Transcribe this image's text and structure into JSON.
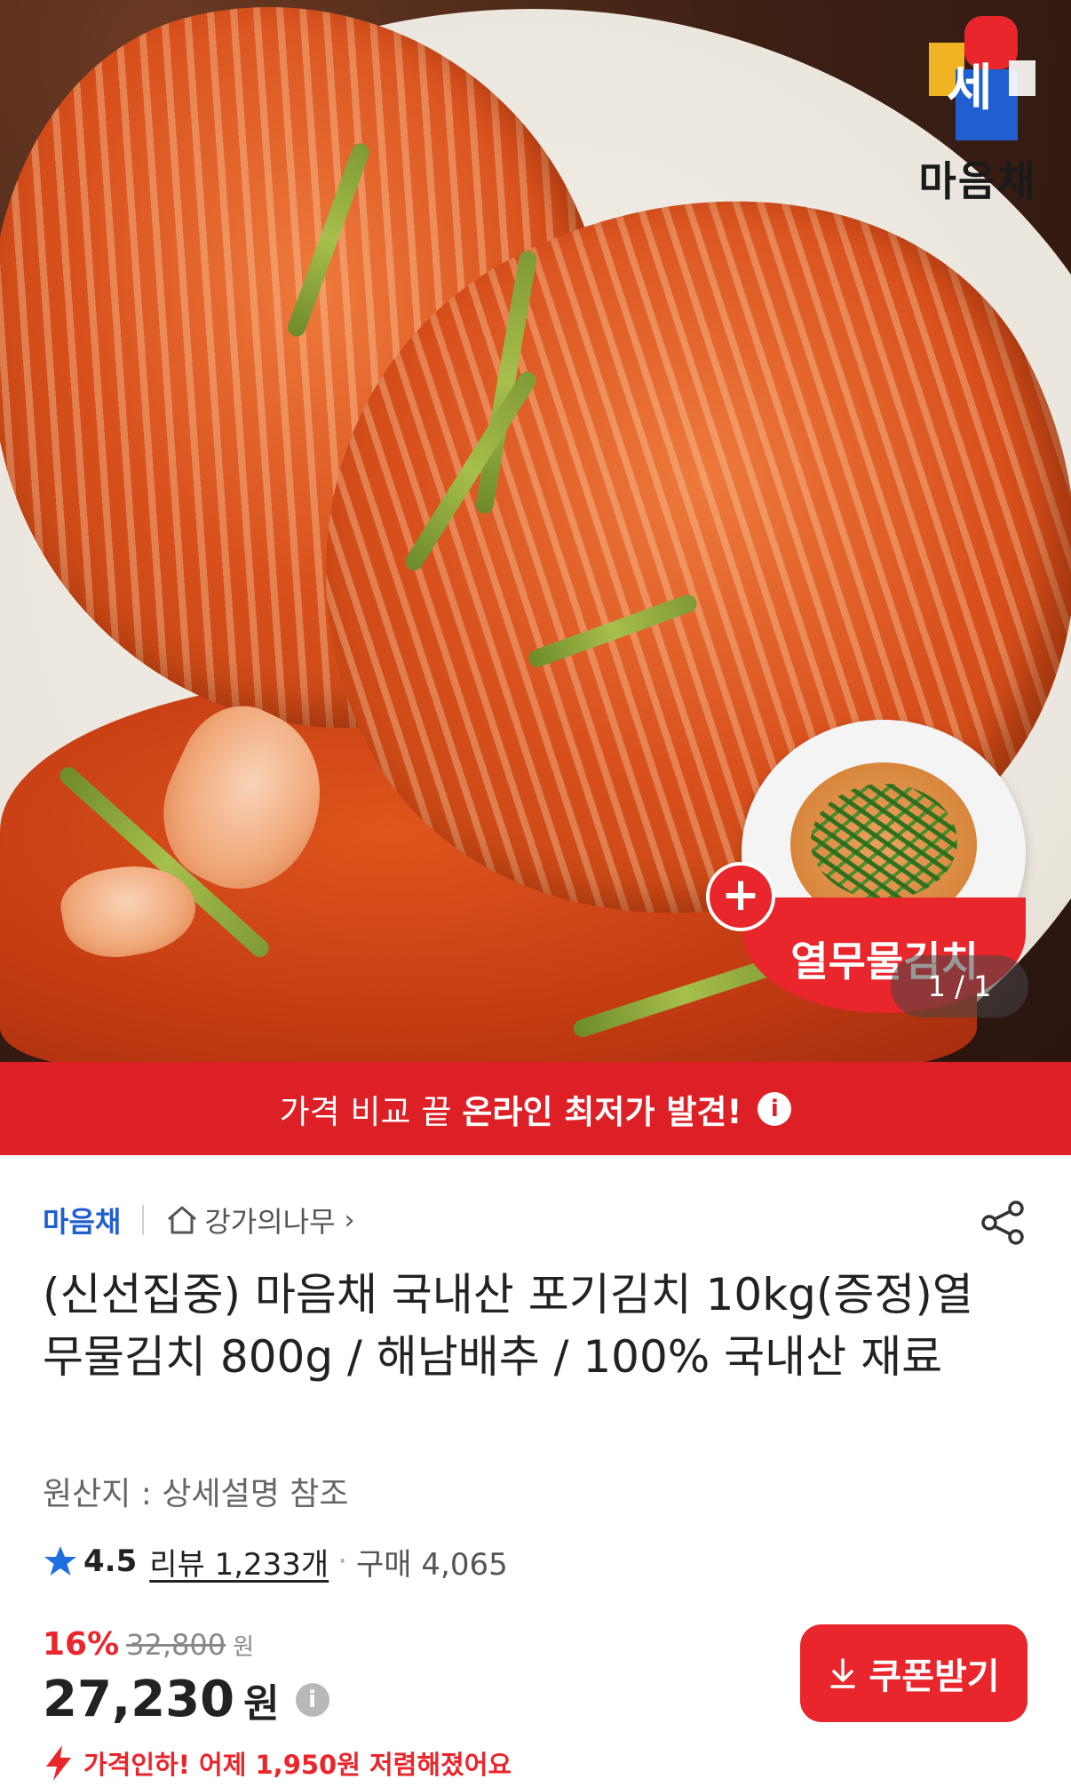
{
  "hero": {
    "logo_text": "마음채",
    "promo_label": "열무물김치",
    "promo_plus": "+",
    "image_counter": "1 / 1"
  },
  "banner": {
    "text_plain": "가격 비교 끝",
    "text_bold": "온라인 최저가 발견!",
    "info_icon": "i"
  },
  "seller": {
    "brand": "마음채",
    "store": "강가의나무",
    "store_arrow": "›"
  },
  "product": {
    "title": "(신선집중) 마음채 국내산 포기김치 10kg(증정)열무물김치 800g / 해남배추 / 100% 국내산 재료",
    "origin": "원산지 : 상세설명 참조"
  },
  "rating": {
    "score": "4.5",
    "reviews": "리뷰 1,233개",
    "separator": "·",
    "purchases": "구매 4,065"
  },
  "price": {
    "discount": "16%",
    "original": "32,800",
    "original_unit": "원",
    "current": "27,230",
    "current_unit": "원",
    "info_icon": "i"
  },
  "coupon": {
    "label": "쿠폰받기"
  },
  "price_drop": {
    "text": "가격인하! 어제 1,950원 저렴해졌어요"
  },
  "colors": {
    "accent_red": "#e8262c",
    "brand_blue": "#1f5fd0"
  }
}
